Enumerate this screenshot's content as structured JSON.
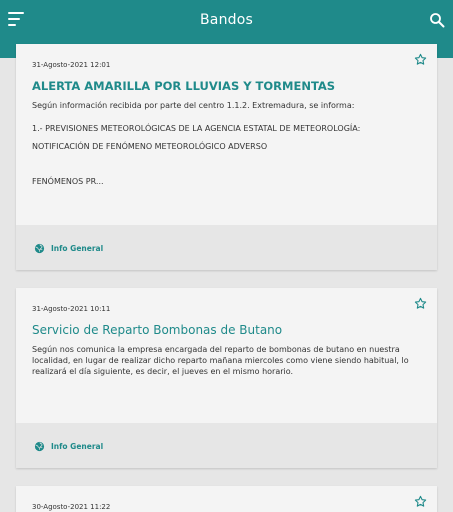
{
  "appbar": {
    "title": "Bandos",
    "menu_icon": "menu-icon",
    "search_icon": "search-icon",
    "color": "#1f8a8a"
  },
  "cards": [
    {
      "date": "31-Agosto-2021 12:01",
      "title": "ALERTA AMARILLA POR LLUVIAS Y TORMENTAS",
      "body": [
        "Según información recibida por parte del centro 1.1.2. Extremadura, se informa:",
        "1.- PREVISIONES METEOROLÓGICAS DE LA AGENCIA ESTATAL DE METEOROLOGÍA:",
        "NOTIFICACIÓN DE FENÓMENO METEOROLÓGICO ADVERSO",
        "FENÓMENOS PR..."
      ],
      "tag": "Info General"
    },
    {
      "date": "31-Agosto-2021 10:11",
      "title": "Servicio de Reparto Bombonas de Butano",
      "body": [
        "Según nos comunica la empresa encargada del reparto de bombonas de butano en nuestra localidad, en lugar de realizar dicho reparto mañana miercoles como viene siendo habitual, lo realizará el día siguiente, es decir, el jueves en el mismo horario."
      ],
      "tag": "Info General"
    },
    {
      "date": "30-Agosto-2021 11:22"
    }
  ]
}
